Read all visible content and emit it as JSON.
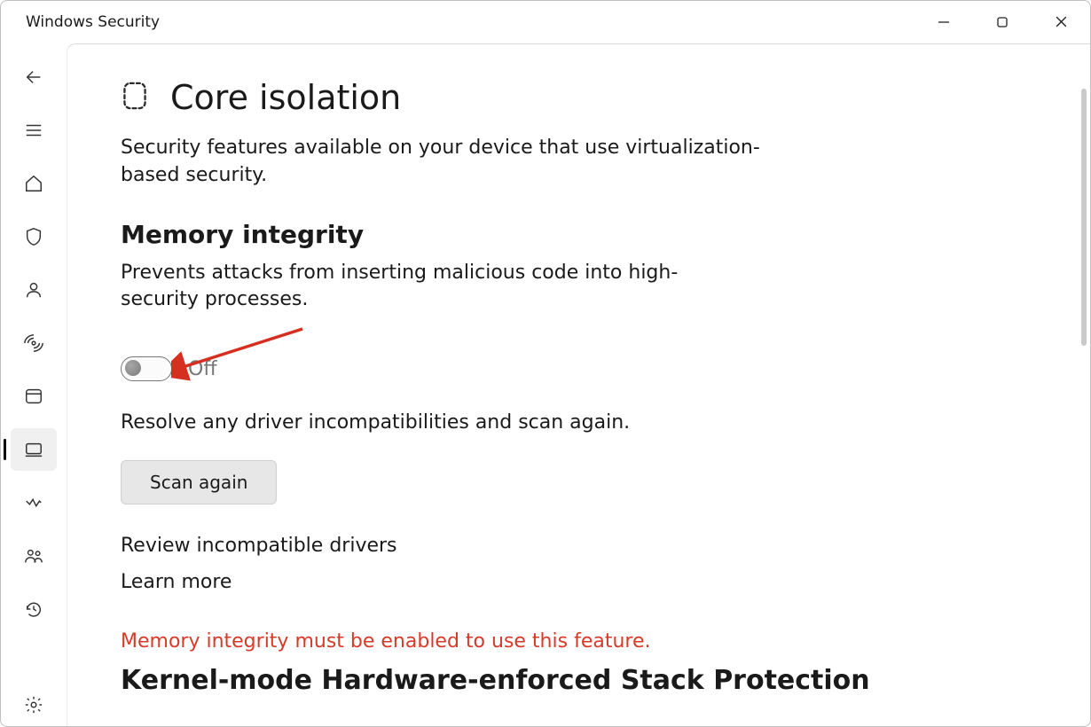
{
  "window": {
    "title": "Windows Security"
  },
  "sidebar": {
    "items": [
      {
        "name": "back-icon"
      },
      {
        "name": "menu-icon"
      },
      {
        "name": "home-icon"
      },
      {
        "name": "shield-icon"
      },
      {
        "name": "account-icon"
      },
      {
        "name": "firewall-icon"
      },
      {
        "name": "app-browser-icon"
      },
      {
        "name": "device-security-icon"
      },
      {
        "name": "device-performance-icon"
      },
      {
        "name": "family-icon"
      },
      {
        "name": "history-icon"
      }
    ],
    "settings": {
      "name": "settings-icon"
    }
  },
  "page": {
    "title": "Core isolation",
    "subtitle": "Security features available on your device that use virtualization-based security."
  },
  "memory_integrity": {
    "heading": "Memory integrity",
    "description": "Prevents attacks from inserting malicious code into high-security processes.",
    "toggle_state": "Off",
    "hint": "Resolve any driver incompatibilities and scan again.",
    "scan_button": "Scan again",
    "review_link": "Review incompatible drivers",
    "learn_more": "Learn more"
  },
  "stack_protection": {
    "warning": "Memory integrity must be enabled to use this feature.",
    "heading": "Kernel-mode Hardware-enforced Stack Protection"
  }
}
